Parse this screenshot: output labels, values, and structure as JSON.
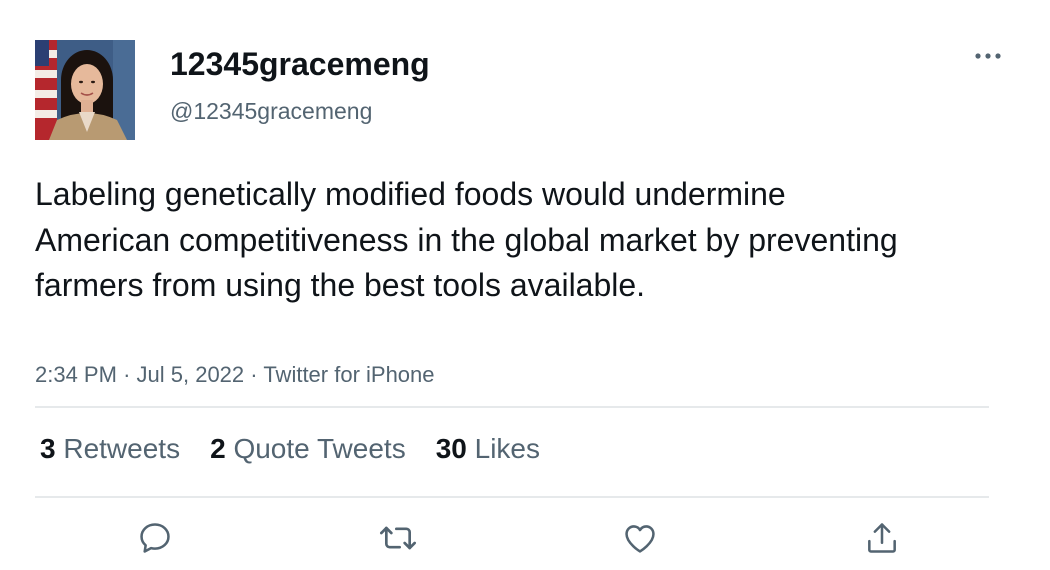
{
  "author": {
    "display_name": "12345gracemeng",
    "handle": "@12345gracemeng",
    "avatar_icon": "profile-photo"
  },
  "tweet": {
    "text": "Labeling genetically modified foods would undermine American competitiveness in the global market by preventing farmers from using the best tools available.",
    "time": "2:34 PM",
    "date": "Jul 5, 2022",
    "source": "Twitter for iPhone",
    "separator": "·"
  },
  "stats": {
    "retweets": {
      "count": "3",
      "label": "Retweets"
    },
    "quotes": {
      "count": "2",
      "label": "Quote Tweets"
    },
    "likes": {
      "count": "30",
      "label": "Likes"
    }
  },
  "actions": {
    "icons": [
      "reply-icon",
      "retweet-icon",
      "like-icon",
      "share-icon"
    ]
  },
  "colors": {
    "text": "#0f1419",
    "muted": "#536471",
    "divider": "#e6e9eb"
  }
}
